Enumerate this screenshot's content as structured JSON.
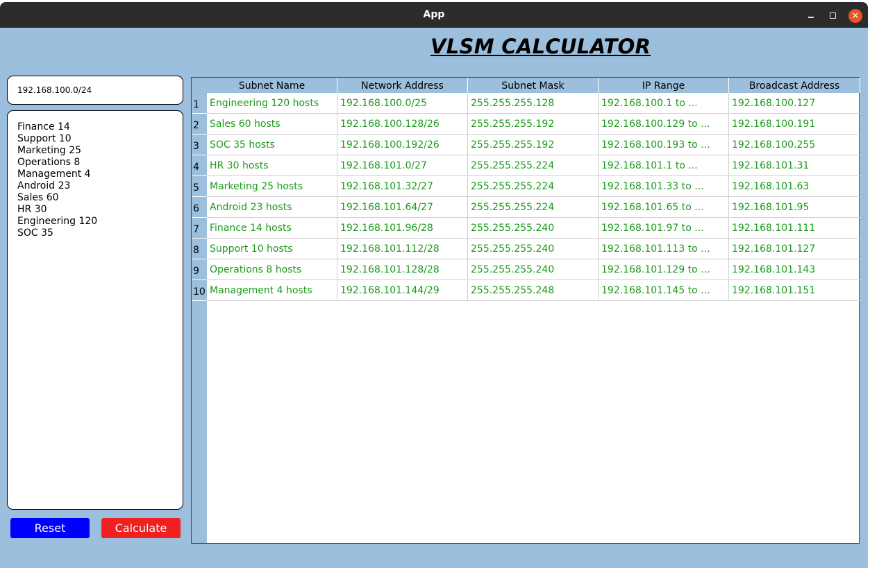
{
  "window": {
    "title": "App"
  },
  "app_title": "VLSM CALCULATOR",
  "network_input": {
    "value": "192.168.100.0/24"
  },
  "subnet_list": [
    "Finance 14",
    "Support 10",
    "Marketing 25",
    "Operations 8",
    "Management 4",
    "Android 23",
    "Sales 60",
    "HR 30",
    "Engineering 120",
    "SOC 35"
  ],
  "buttons": {
    "reset": "Reset",
    "calculate": "Calculate"
  },
  "colors": {
    "background": "#9bbfdd",
    "cell_text": "#1a9a1a",
    "reset_button": "#0000ff",
    "calculate_button": "#f02020",
    "close_button": "#e95420"
  },
  "table": {
    "headers": [
      "Subnet Name",
      "Network Address",
      "Subnet Mask",
      "IP Range",
      "Broadcast Address"
    ],
    "rows": [
      {
        "num": "1",
        "cells": [
          "Engineering 120 hosts",
          "192.168.100.0/25",
          "255.255.255.128",
          "192.168.100.1 to ...",
          "192.168.100.127"
        ]
      },
      {
        "num": "2",
        "cells": [
          "Sales 60 hosts",
          "192.168.100.128/26",
          "255.255.255.192",
          "192.168.100.129 to ...",
          "192.168.100.191"
        ]
      },
      {
        "num": "3",
        "cells": [
          "SOC 35 hosts",
          "192.168.100.192/26",
          "255.255.255.192",
          "192.168.100.193 to ...",
          "192.168.100.255"
        ]
      },
      {
        "num": "4",
        "cells": [
          "HR 30 hosts",
          "192.168.101.0/27",
          "255.255.255.224",
          "192.168.101.1 to ...",
          "192.168.101.31"
        ]
      },
      {
        "num": "5",
        "cells": [
          "Marketing 25 hosts",
          "192.168.101.32/27",
          "255.255.255.224",
          "192.168.101.33 to ...",
          "192.168.101.63"
        ]
      },
      {
        "num": "6",
        "cells": [
          "Android 23 hosts",
          "192.168.101.64/27",
          "255.255.255.224",
          "192.168.101.65 to ...",
          "192.168.101.95"
        ]
      },
      {
        "num": "7",
        "cells": [
          "Finance 14 hosts",
          "192.168.101.96/28",
          "255.255.255.240",
          "192.168.101.97 to ...",
          "192.168.101.111"
        ]
      },
      {
        "num": "8",
        "cells": [
          "Support 10 hosts",
          "192.168.101.112/28",
          "255.255.255.240",
          "192.168.101.113 to ...",
          "192.168.101.127"
        ]
      },
      {
        "num": "9",
        "cells": [
          "Operations 8 hosts",
          "192.168.101.128/28",
          "255.255.255.240",
          "192.168.101.129 to ...",
          "192.168.101.143"
        ]
      },
      {
        "num": "10",
        "cells": [
          "Management 4 hosts",
          "192.168.101.144/29",
          "255.255.255.248",
          "192.168.101.145 to ...",
          "192.168.101.151"
        ]
      }
    ]
  }
}
